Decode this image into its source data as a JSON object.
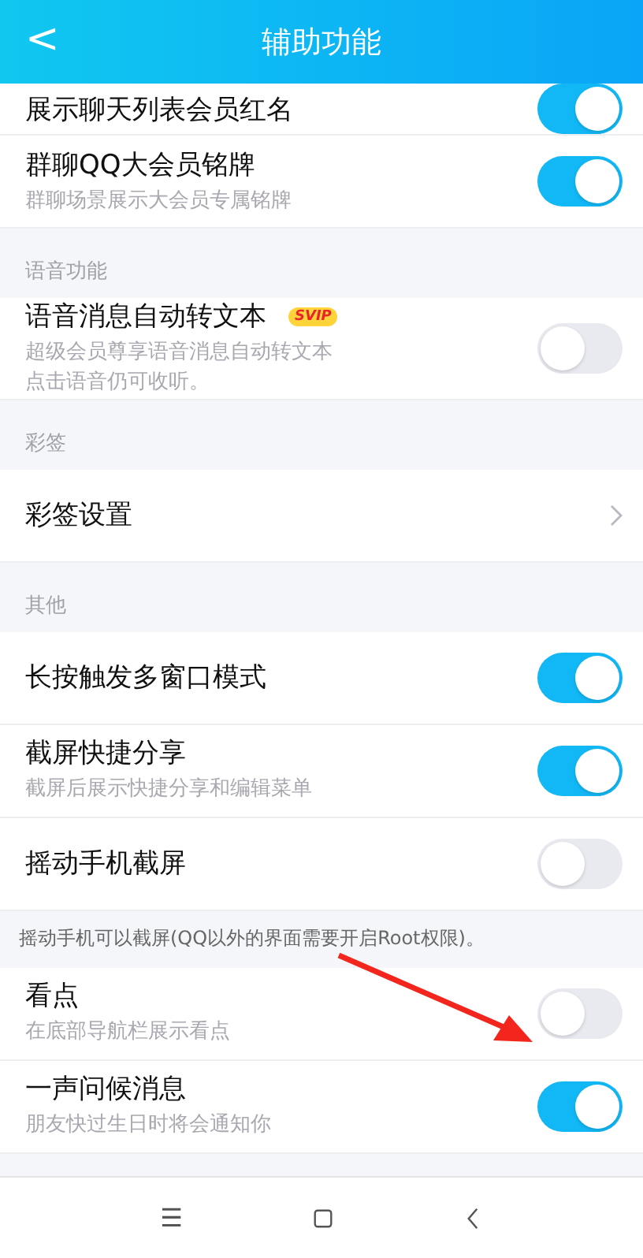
{
  "header": {
    "back": "<",
    "title": "辅助功能"
  },
  "items": [
    {
      "kind": "toggle",
      "title": "展示聊天列表会员红名",
      "on": true,
      "compact": true
    },
    {
      "kind": "toggle",
      "title": "群聊QQ大会员铭牌",
      "subtitle": "群聊场景展示大会员专属铭牌",
      "on": true
    },
    {
      "kind": "section",
      "title": "语音功能"
    },
    {
      "kind": "toggle",
      "title": "语音消息自动转文本",
      "badge": "SVIP",
      "subtitle": "超级会员尊享语音消息自动转文本点击语音仍可收听。",
      "on": false
    },
    {
      "kind": "section",
      "title": "彩签"
    },
    {
      "kind": "link",
      "title": "彩签设置"
    },
    {
      "kind": "section",
      "title": "其他"
    },
    {
      "kind": "toggle",
      "title": "长按触发多窗口模式",
      "on": true
    },
    {
      "kind": "toggle",
      "title": "截屏快捷分享",
      "subtitle": "截屏后展示快捷分享和编辑菜单",
      "on": true
    },
    {
      "kind": "toggle",
      "title": "摇动手机截屏",
      "on": false
    },
    {
      "kind": "note",
      "title": "摇动手机可以截屏(QQ以外的界面需要开启Root权限)。"
    },
    {
      "kind": "toggle",
      "title": "看点",
      "subtitle": "在底部导航栏展示看点",
      "on": false
    },
    {
      "kind": "toggle",
      "title": "一声问候消息",
      "subtitle": "朋友快过生日时将会通知你",
      "on": true
    }
  ],
  "navbar": {
    "menu": "☰"
  }
}
